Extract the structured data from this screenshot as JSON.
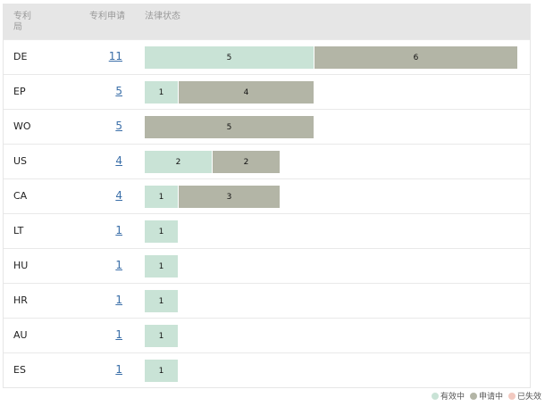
{
  "header": {
    "office_label": "专利局",
    "count_label": "专利申请",
    "status_label": "法律状态"
  },
  "rows": [
    {
      "office": "DE",
      "count": "11",
      "valid": 5,
      "pending": 6,
      "lapsed": 0
    },
    {
      "office": "EP",
      "count": "5",
      "valid": 1,
      "pending": 4,
      "lapsed": 0
    },
    {
      "office": "WO",
      "count": "5",
      "valid": 0,
      "pending": 5,
      "lapsed": 0
    },
    {
      "office": "US",
      "count": "4",
      "valid": 2,
      "pending": 2,
      "lapsed": 0
    },
    {
      "office": "CA",
      "count": "4",
      "valid": 1,
      "pending": 3,
      "lapsed": 0
    },
    {
      "office": "LT",
      "count": "1",
      "valid": 1,
      "pending": 0,
      "lapsed": 0
    },
    {
      "office": "HU",
      "count": "1",
      "valid": 1,
      "pending": 0,
      "lapsed": 0
    },
    {
      "office": "HR",
      "count": "1",
      "valid": 1,
      "pending": 0,
      "lapsed": 0
    },
    {
      "office": "AU",
      "count": "1",
      "valid": 1,
      "pending": 0,
      "lapsed": 0
    },
    {
      "office": "ES",
      "count": "1",
      "valid": 1,
      "pending": 0,
      "lapsed": 0
    }
  ],
  "legend": [
    {
      "key": "valid",
      "label": "有效中",
      "color": "#c9e3d6"
    },
    {
      "key": "pending",
      "label": "申请中",
      "color": "#b3b5a6"
    },
    {
      "key": "lapsed",
      "label": "已失效",
      "color": "#f2c9c0"
    }
  ],
  "colors": {
    "valid": "#c9e3d6",
    "pending": "#b3b5a6",
    "lapsed": "#f2c9c0",
    "link": "#3a6ea8"
  }
}
